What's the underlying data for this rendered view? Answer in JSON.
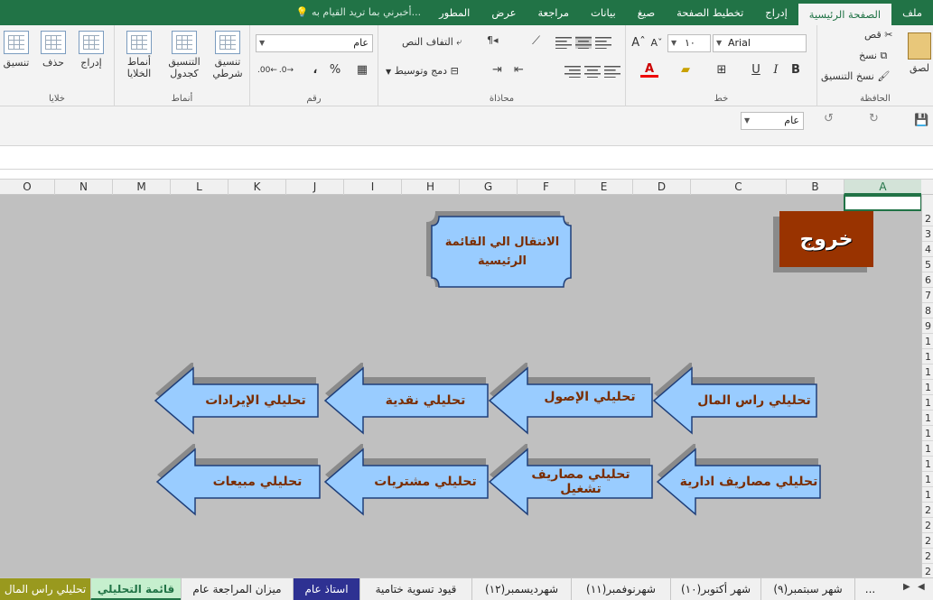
{
  "tabs": [
    {
      "label": "ملف"
    },
    {
      "label": "الصفحة الرئيسية",
      "active": true
    },
    {
      "label": "إدراج"
    },
    {
      "label": "تخطيط الصفحة"
    },
    {
      "label": "صيغ"
    },
    {
      "label": "بيانات"
    },
    {
      "label": "مراجعة"
    },
    {
      "label": "عرض"
    },
    {
      "label": "المطور"
    }
  ],
  "tell_me": "أخبرني بما تريد القيام به...",
  "ribbon": {
    "clipboard": {
      "label": "الحافظة",
      "paste": "لصق",
      "cut": "قص",
      "copy": "نسخ",
      "format_painter": "نسخ التنسيق"
    },
    "font": {
      "label": "خط",
      "name": "Arial",
      "size": "١٠",
      "bold": "B",
      "italic": "I",
      "underline": "U"
    },
    "alignment": {
      "label": "محاذاة",
      "wrap": "التفاف النص",
      "merge": "دمج وتوسيط"
    },
    "number": {
      "label": "رقم",
      "format": "عام",
      "percent": "%",
      "comma": "،"
    },
    "styles": {
      "label": "أنماط",
      "conditional": "تنسيق شرطي",
      "table": "التنسيق كجدول",
      "cell_styles": "أنماط الخلايا"
    },
    "cells": {
      "label": "خلايا",
      "insert": "إدراج",
      "delete": "حذف",
      "format": "تنسيق"
    }
  },
  "qat": {
    "format_value": "عام"
  },
  "columns": [
    "A",
    "B",
    "C",
    "D",
    "E",
    "F",
    "G",
    "H",
    "I",
    "J",
    "K",
    "L",
    "M",
    "N",
    "O"
  ],
  "rows": [
    "2",
    "3",
    "4",
    "5",
    "6",
    "7",
    "8",
    "9",
    "1",
    "1",
    "1",
    "1",
    "1",
    "1",
    "1",
    "1",
    "1",
    "1",
    "1",
    "2",
    "2",
    "2",
    "2",
    "2"
  ],
  "shapes": {
    "exit": "خروج",
    "main_menu": "الانتقال الي القائمة الرئيسية",
    "arrows": [
      {
        "label": "تحليلي راس المال"
      },
      {
        "label": "تحليلي الإصول"
      },
      {
        "label": "تحليلي نقدية"
      },
      {
        "label": "تحليلي الإيرادات"
      },
      {
        "label": "تحليلي مصاريف ادارية"
      },
      {
        "label": "تحليلي مصاريف تشغيل"
      },
      {
        "label": "تحليلي مشتريات"
      },
      {
        "label": "تحليلي مبيعات"
      }
    ]
  },
  "sheets": [
    {
      "label": "..."
    },
    {
      "label": "شهر سبتمبر(٩)"
    },
    {
      "label": "شهر أكتوبر(١٠)"
    },
    {
      "label": "شهرنوفمبر(١١)"
    },
    {
      "label": "شهرديسمبر(١٢)"
    },
    {
      "label": "قيود تسوية ختامية"
    },
    {
      "label": "استاذ عام"
    },
    {
      "label": "ميزان المراجعة عام"
    },
    {
      "label": "قائمة التحليلي"
    },
    {
      "label": "تحليلي راس المال"
    }
  ],
  "colors": {
    "excel_green": "#217346",
    "arrow_fill": "#99ccff",
    "exit_fill": "#993300",
    "sheet_blue": "#2e3192",
    "sheet_green": "#c6efce",
    "sheet_olive": "#99991e",
    "label_text": "#7a2d00"
  }
}
